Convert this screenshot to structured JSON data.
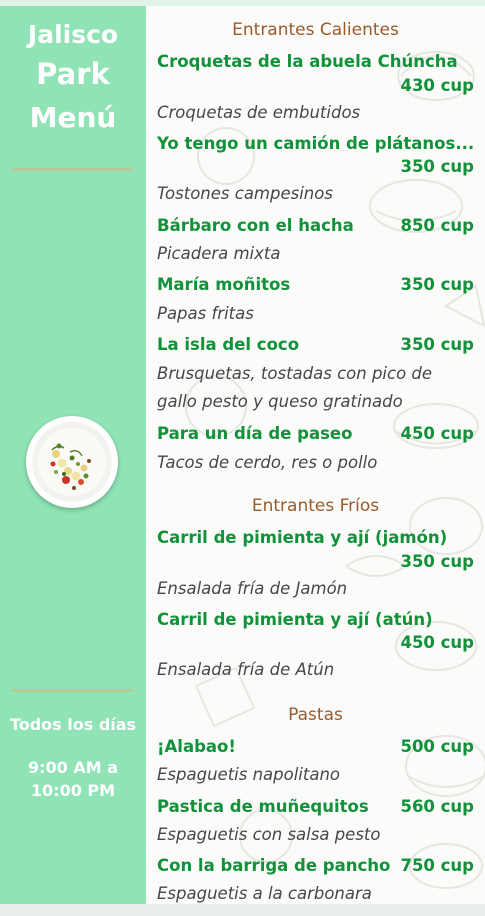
{
  "sidebar": {
    "brand": {
      "line1": "Jalisco",
      "line2": "Park",
      "line3": "Menú"
    },
    "schedule": {
      "days": "Todos los días",
      "time_start": "9:00 AM a",
      "time_end": "10:00 PM"
    },
    "image": "plated-dish-photo"
  },
  "sections": [
    {
      "title": "Entrantes Calientes",
      "items": [
        {
          "name": "Croquetas de la abuela Chúncha",
          "price": "430 cup",
          "desc": "Croquetas de embutidos"
        },
        {
          "name": "Yo tengo un camión de plátanos...",
          "price": "350 cup",
          "desc": "Tostones campesinos"
        },
        {
          "name": "Bárbaro con el hacha",
          "price": "850 cup",
          "desc": "Picadera mixta"
        },
        {
          "name": "María moñitos",
          "price": "350 cup",
          "desc": "Papas fritas"
        },
        {
          "name": "La isla del coco",
          "price": "350 cup",
          "desc": "Brusquetas, tostadas con pico de",
          "desc2": "gallo pesto y queso gratinado"
        },
        {
          "name": "Para un día de paseo",
          "price": "450 cup",
          "desc": "Tacos de cerdo, res o pollo"
        }
      ]
    },
    {
      "title": "Entrantes Fríos",
      "items": [
        {
          "name": "Carril de pimienta y ají (jamón)",
          "price": "350 cup",
          "desc": "Ensalada fría de Jamón"
        },
        {
          "name": "Carril de pimienta y ají (atún)",
          "price": "450 cup",
          "desc": "Ensalada fría de Atún"
        }
      ]
    },
    {
      "title": "Pastas",
      "items": [
        {
          "name": "¡Alabao!",
          "price": "500 cup",
          "desc": "Espaguetis napolitano"
        },
        {
          "name": "Pastica de muñequitos",
          "price": "560 cup",
          "desc": "Espaguetis con salsa pesto"
        },
        {
          "name": "Con la barriga de pancho",
          "price": "750 cup",
          "desc": "Espaguetis a la carbonara"
        }
      ]
    }
  ],
  "colors": {
    "sidebar": "#8fe3b5",
    "dish_name": "#11913a",
    "section_title": "#9a5a2a",
    "description": "#474747"
  }
}
